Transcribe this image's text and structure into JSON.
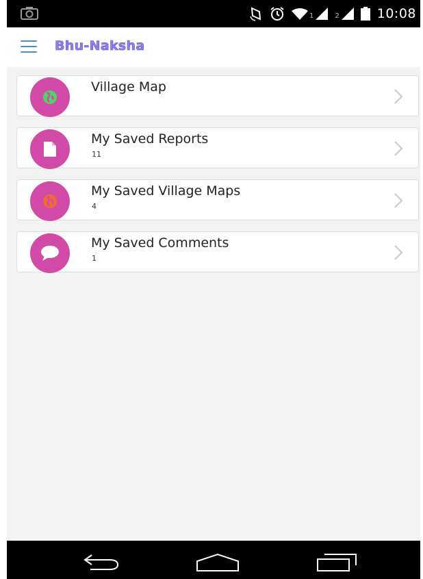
{
  "status_bar": {
    "sim1_label": "1",
    "sim2_label": "2",
    "time": "10:08",
    "icons": [
      "camera-icon",
      "rotate-icon",
      "alarm-icon",
      "wifi-icon",
      "signal-icon",
      "battery-icon"
    ]
  },
  "app_bar": {
    "title": "Bhu-Naksha",
    "menu_icon": "hamburger-menu-icon",
    "title_color": "#8f82e6"
  },
  "menu_items": [
    {
      "label": "Village Map",
      "count": "",
      "icon": "globe-icon"
    },
    {
      "label": "My Saved Reports",
      "count": "11",
      "icon": "document-icon"
    },
    {
      "label": "My Saved Village Maps",
      "count": "4",
      "icon": "globe-icon"
    },
    {
      "label": "My Saved Comments",
      "count": "1",
      "icon": "comment-bubble-icon"
    }
  ],
  "colors": {
    "icon_circle": "#d14aa8",
    "background": "#f3f3f3",
    "menu_icon": "#4d8ad8"
  },
  "nav_bar": {
    "icons": [
      "back-icon",
      "home-icon",
      "recent-apps-icon"
    ]
  }
}
